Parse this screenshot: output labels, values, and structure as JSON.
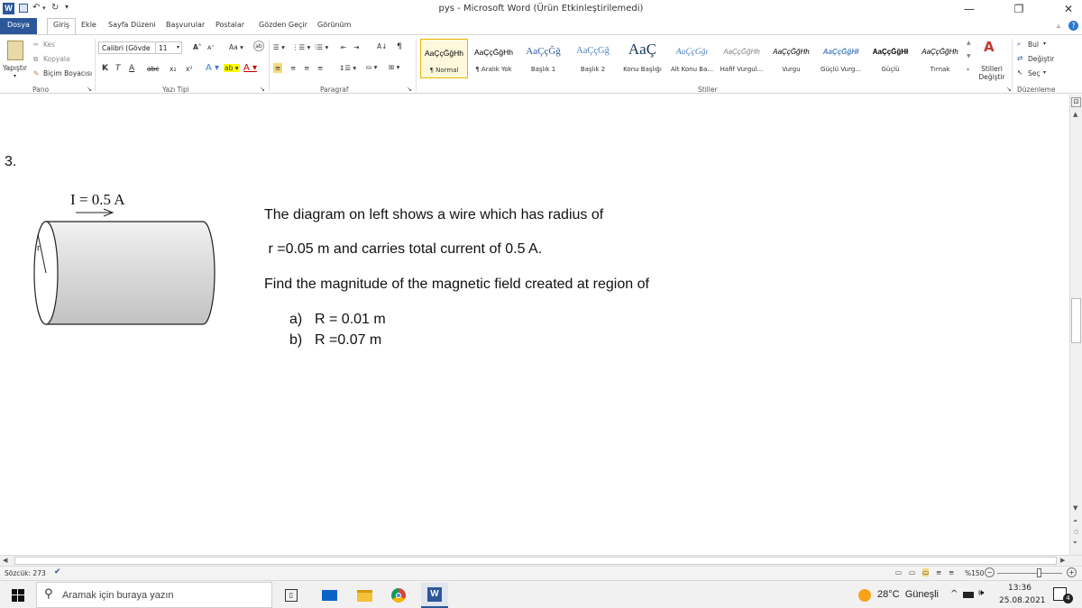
{
  "window": {
    "title": "pys  -  Microsoft Word (Ürün Etkinleştirilemedi)",
    "minimize": "—",
    "maximize": "❐",
    "close": "✕"
  },
  "tabs": [
    "Dosya",
    "Giriş",
    "Ekle",
    "Sayfa Düzeni",
    "Başvurular",
    "Postalar",
    "Gözden Geçir",
    "Görünüm"
  ],
  "ribbon": {
    "clipboard": {
      "paste": "Yapıştır",
      "cut": "Kes",
      "copy": "Kopyala",
      "format_painter": "Biçim Boyacısı",
      "group": "Pano"
    },
    "font": {
      "name": "Calibri (Gövde",
      "size": "11",
      "group": "Yazı Tipi",
      "bold": "K",
      "italic": "T",
      "underline": "A",
      "strike": "abc",
      "sub": "x₂",
      "sup": "x²"
    },
    "paragraph": {
      "group": "Paragraf"
    },
    "styles": {
      "group": "Stiller",
      "change_styles": "Stilleri Değiştir",
      "items": [
        {
          "sample": "AaÇçĞğHh",
          "name": "¶ Normal"
        },
        {
          "sample": "AaÇçĞğHh",
          "name": "¶ Aralık Yok"
        },
        {
          "sample": "AaÇçĞğ",
          "name": "Başlık 1"
        },
        {
          "sample": "AaÇçĞğ",
          "name": "Başlık 2"
        },
        {
          "sample": "AaÇ",
          "name": "Konu Başlığı"
        },
        {
          "sample": "AaÇçĞğı",
          "name": "Alt Konu Ba..."
        },
        {
          "sample": "AaÇçĞğHh",
          "name": "Hafif Vurgul..."
        },
        {
          "sample": "AaÇçĞğHh",
          "name": "Vurgu"
        },
        {
          "sample": "AaÇçĞğHł",
          "name": "Güçlü Vurg..."
        },
        {
          "sample": "AaÇçĞğHł",
          "name": "Güçlü"
        },
        {
          "sample": "AaÇçĞğHh",
          "name": "Tırnak"
        }
      ]
    },
    "editing": {
      "find": "Bul",
      "replace": "Değiştir",
      "select": "Seç",
      "group": "Düzenleme"
    }
  },
  "document": {
    "question_number": "3.",
    "figure_current_label": "I = 0.5 A",
    "figure_radius_label": "r",
    "line1": "The diagram on left shows a wire which has  radius of",
    "line2": " r =0.05 m and carries total current of 0.5 A.",
    "line3": "Find the magnitude of the magnetic field created at region of",
    "option_a_marker": "a)",
    "option_a": "R = 0.01 m",
    "option_b_marker": "b)",
    "option_b": "R =0.07 m"
  },
  "status": {
    "word_count": "Sözcük: 273",
    "zoom": "%150"
  },
  "taskbar": {
    "search_placeholder": "Aramak için buraya yazın",
    "weather": "28°C  Güneşli",
    "time": "13:36",
    "date": "25.08.2021",
    "notifications": "4"
  },
  "colors": {
    "file_tab": "#2b579a",
    "accent": "#2b579a",
    "selected_style": "#e6b400"
  }
}
